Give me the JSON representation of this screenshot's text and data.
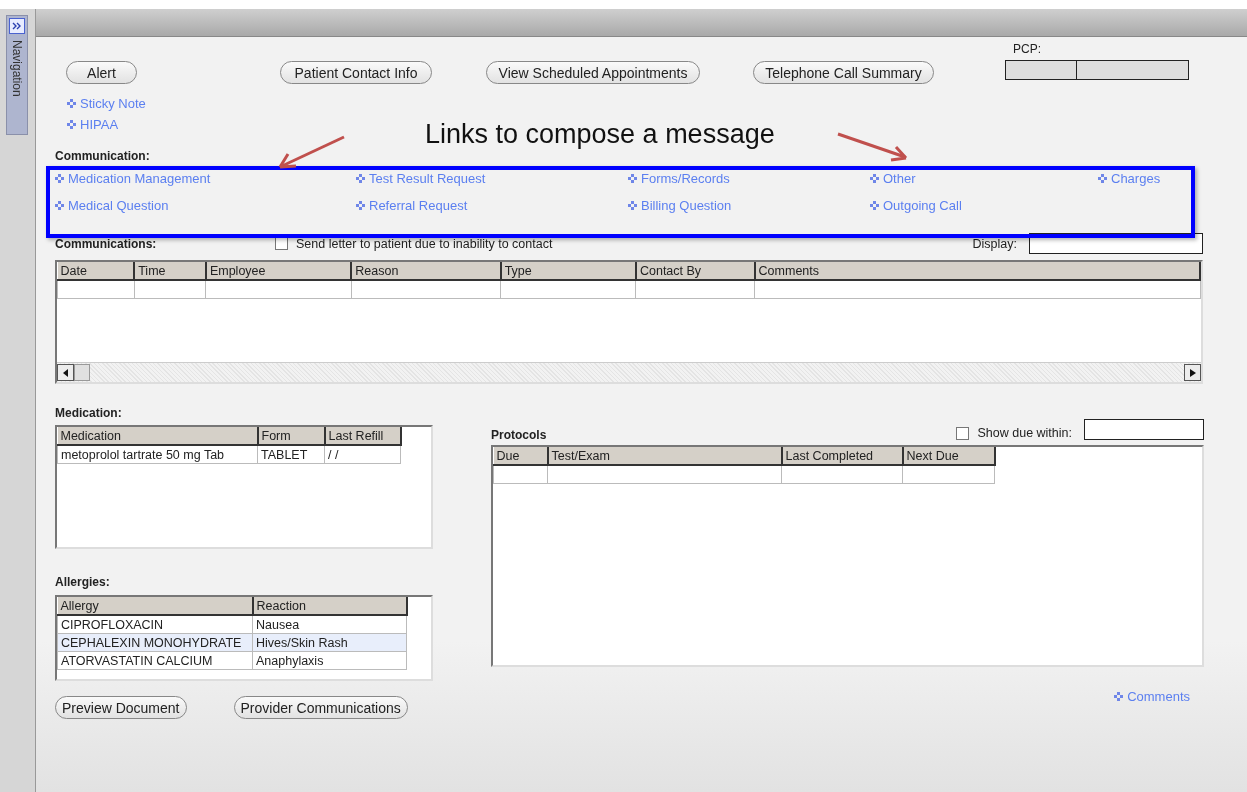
{
  "top_buttons": [
    "Alert",
    "Patient Contact Info",
    "View Scheduled Appointments",
    "Telephone Call Summary"
  ],
  "sidebar": {
    "label": "Navigation"
  },
  "pcp": {
    "label": "PCP:"
  },
  "quick_links": [
    "Sticky Note",
    "HIPAA"
  ],
  "annotation": {
    "text": "Links to compose a message"
  },
  "communication": {
    "title": "Communication:",
    "links": [
      "Medication Management",
      "Test Result Request",
      "Forms/Records",
      "Other",
      "Charges",
      "Medical Question",
      "Referral Request",
      "Billing Question",
      "Outgoing Call"
    ]
  },
  "communications": {
    "title": "Communications:",
    "send_letter": {
      "label": "Send letter to patient due to inability to contact",
      "checked": false
    },
    "display_label": "Display:",
    "columns": [
      "Date",
      "Time",
      "Employee",
      "Reason",
      "Type",
      "Contact By",
      "Comments"
    ]
  },
  "medication": {
    "title": "Medication:",
    "columns": [
      "Medication",
      "Form",
      "Last Refill"
    ],
    "rows": [
      {
        "cells": [
          "metoprolol tartrate 50 mg Tab",
          "TABLET",
          "/ /"
        ],
        "selected": false
      }
    ]
  },
  "allergies": {
    "title": "Allergies:",
    "columns": [
      "Allergy",
      "Reaction"
    ],
    "rows": [
      {
        "cells": [
          "CIPROFLOXACIN",
          "Nausea"
        ],
        "selected": false
      },
      {
        "cells": [
          "CEPHALEXIN MONOHYDRATE",
          "Hives/Skin Rash"
        ],
        "selected": true
      },
      {
        "cells": [
          "ATORVASTATIN CALCIUM",
          "Anaphylaxis"
        ],
        "selected": false
      }
    ]
  },
  "bottom_buttons": [
    "Preview Document",
    "Provider Communications"
  ],
  "protocols": {
    "title": "Protocols",
    "show_due": {
      "label": "Show due within:",
      "checked": false
    },
    "columns": [
      "Due",
      "Test/Exam",
      "Last Completed",
      "Next Due"
    ]
  },
  "comments_link": "Comments"
}
